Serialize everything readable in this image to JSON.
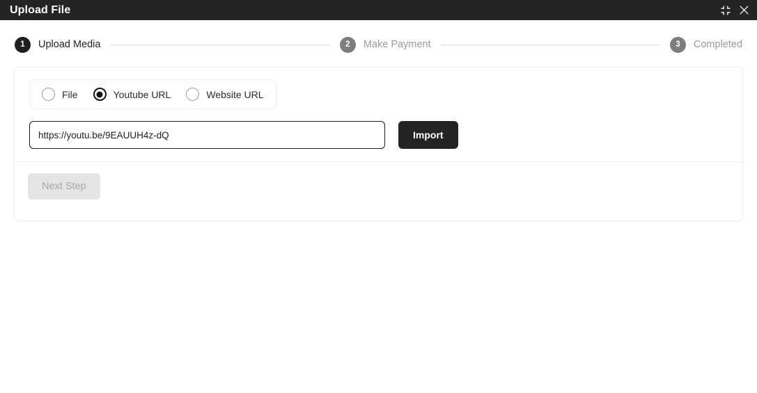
{
  "titlebar": {
    "title": "Upload File",
    "collapse_icon": "collapse-arrows-icon",
    "close_icon": "close-icon",
    "background": "#242424"
  },
  "stepper": {
    "steps": [
      {
        "number": "1",
        "label": "Upload Media",
        "state": "active"
      },
      {
        "number": "2",
        "label": "Make Payment",
        "state": "inactive"
      },
      {
        "number": "3",
        "label": "Completed",
        "state": "inactive"
      }
    ],
    "active_color": "#1f1f1f",
    "inactive_color": "#7d7d7d",
    "line_color": "#dcdcdc"
  },
  "source_options": {
    "items": [
      {
        "label": "File",
        "checked": false
      },
      {
        "label": "Youtube URL",
        "checked": true
      },
      {
        "label": "Website URL",
        "checked": false
      }
    ],
    "selected": "Youtube URL"
  },
  "url_field": {
    "value": "https://youtu.be/9EAUUH4z-dQ",
    "placeholder": "",
    "focused": true
  },
  "buttons": {
    "import_label": "Import",
    "import_color": "#242424",
    "next_label": "Next Step",
    "next_disabled": true,
    "next_color": "#e4e4e4",
    "next_text_color": "#a8a8a8"
  }
}
